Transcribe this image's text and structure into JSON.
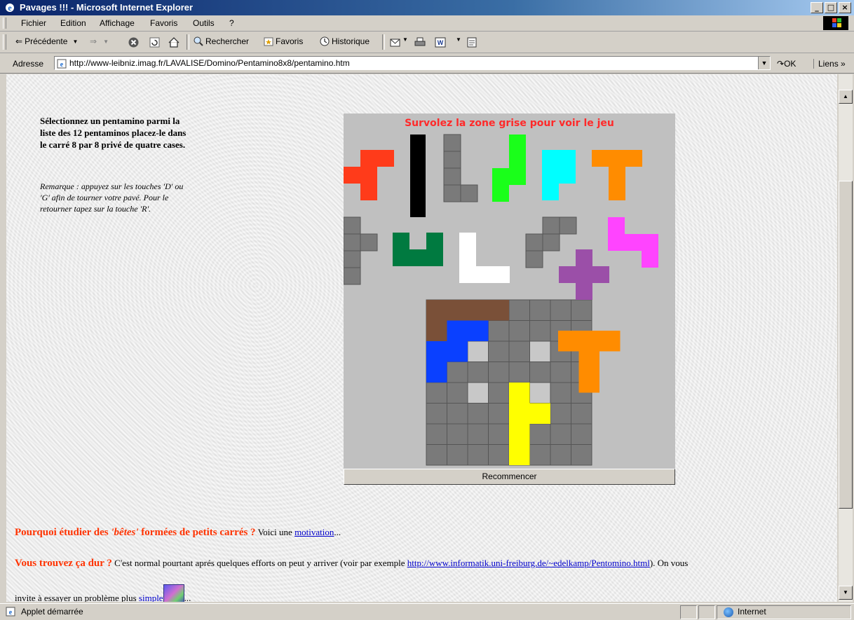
{
  "window": {
    "title": "Pavages !!! - Microsoft Internet Explorer",
    "buttons": [
      "_",
      "□",
      "×"
    ]
  },
  "menu": {
    "items": [
      "Fichier",
      "Edition",
      "Affichage",
      "Favoris",
      "Outils",
      "?"
    ]
  },
  "toolbar": {
    "back": "Précédente",
    "search": "Rechercher",
    "favorites": "Favoris",
    "history": "Historique"
  },
  "address": {
    "label": "Adresse",
    "url": "http://www-leibniz.imag.fr/LAVALISE/Domino/Pentamino8x8/pentamino.htm",
    "go": "OK",
    "links": "Liens"
  },
  "instructions": {
    "main": "Sélectionnez un pentamino parmi la liste des 12 pentaminos placez-le dans le carré 8 par 8 privé de quatre cases.",
    "remark": "Remarque : appuyez sur les touches 'D' ou 'G' afin de tourner votre pavé. Pour le retourner tapez sur la touche 'R'."
  },
  "applet": {
    "hint": "Survolez la zone grise pour voir le jeu",
    "restart": "Recommencer",
    "colors": {
      "bg": "#c0c0c0",
      "grid": "#7a7a7a",
      "hole": "#c8c8c8",
      "red": "#ff3b1a",
      "black": "#000000",
      "green": "#1aff1a",
      "cyan": "#00ffff",
      "orange": "#ff8c00",
      "darkgreen": "#007a40",
      "white": "#ffffff",
      "purple": "#9b4fa8",
      "magenta": "#ff44ff",
      "brown": "#7a5038",
      "blue": "#0a40ff",
      "yellow": "#ffff00"
    }
  },
  "paragraph1": {
    "lead": "Pourquoi étudier des ",
    "emph": "'bêtes'",
    "lead2": " formées de petits carrés ?",
    "text": " Voici une ",
    "link": "motivation",
    "after": "..."
  },
  "paragraph2": {
    "lead": "Vous trouvez ça dur ?",
    "text": " C'est normal pourtant aprés quelques efforts on peut y arriver (voir par exemple ",
    "link": "http://www.informatik.uni-freiburg.de/~edelkamp/Pentomino.html",
    "after": "). On vous"
  },
  "paragraph3": {
    "text": "invite à essayer un problème plus ",
    "link": "simple",
    "after": "..."
  },
  "status": {
    "text": "Applet démarrée",
    "zone": "Internet"
  }
}
